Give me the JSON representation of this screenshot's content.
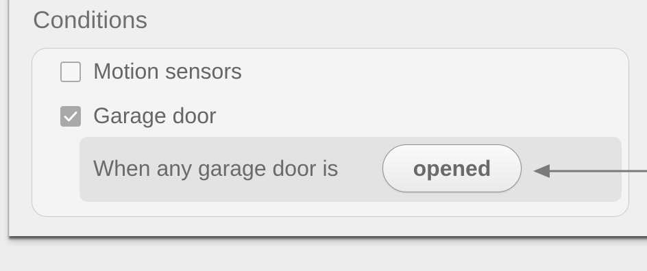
{
  "section": {
    "title": "Conditions"
  },
  "options": [
    {
      "label": "Motion sensors",
      "checked": false
    },
    {
      "label": "Garage door",
      "checked": true
    }
  ],
  "garage_condition": {
    "prefix": "When any garage door is",
    "state": "opened"
  },
  "icons": {
    "checkbox_checked": "checkmark-icon",
    "annotation": "arrow-left-icon"
  },
  "colors": {
    "checkbox_fill": "#a9a9a9",
    "text": "#666666",
    "sub_row_background": "#e3e3e3"
  }
}
